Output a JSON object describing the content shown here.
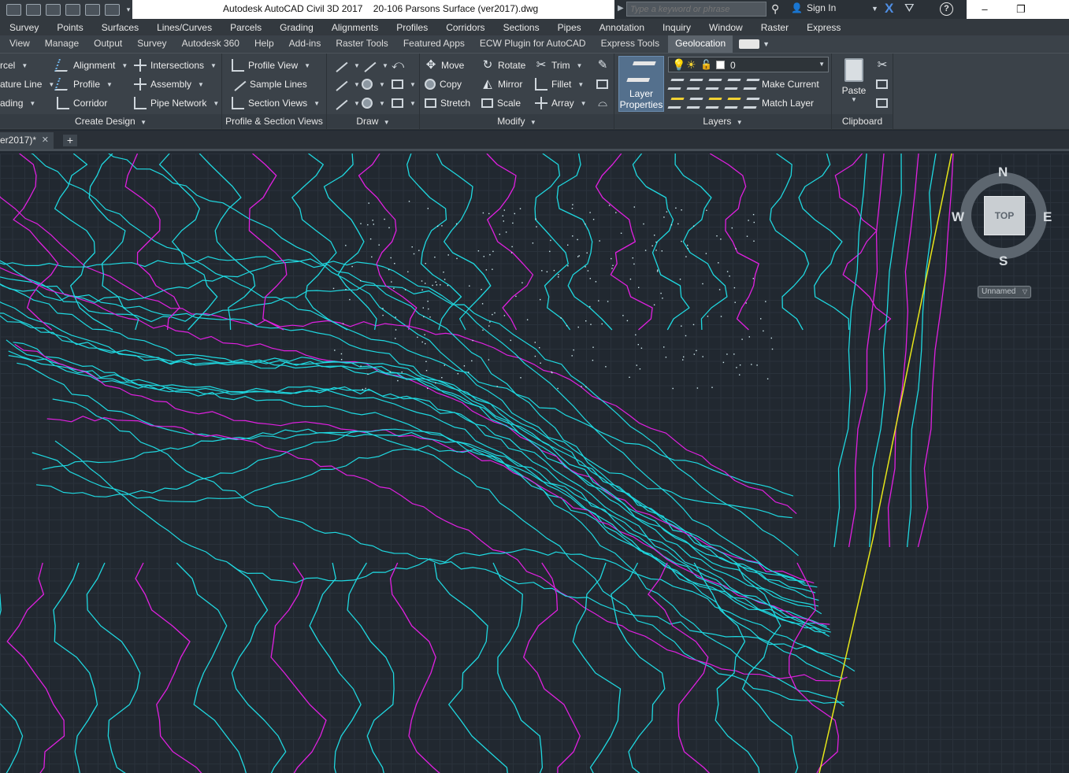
{
  "title_bar": {
    "app_title": "Autodesk AutoCAD Civil 3D 2017",
    "file_name": "20-106 Parsons Surface (ver2017).dwg",
    "search_placeholder": "Type a keyword or phrase",
    "sign_in": "Sign In",
    "minimize": "–",
    "restore": "❐"
  },
  "menu_bar": [
    "Survey",
    "Points",
    "Surfaces",
    "Lines/Curves",
    "Parcels",
    "Grading",
    "Alignments",
    "Profiles",
    "Corridors",
    "Sections",
    "Pipes",
    "Annotation",
    "Inquiry",
    "Window",
    "Raster",
    "Express"
  ],
  "ribbon_tabs": [
    "View",
    "Manage",
    "Output",
    "Survey",
    "Autodesk 360",
    "Help",
    "Add-ins",
    "Raster Tools",
    "Featured Apps",
    "ECW Plugin for AutoCAD",
    "Express Tools",
    "Geolocation"
  ],
  "active_tab": "Geolocation",
  "panels": {
    "create_design": {
      "title": "Create Design",
      "col1": [
        "rcel",
        "ature Line",
        "ading"
      ],
      "col2": [
        "Alignment",
        "Profile",
        "Corridor"
      ],
      "col3": [
        "Intersections",
        "Assembly",
        "Pipe Network"
      ]
    },
    "profile_section": {
      "title": "Profile & Section Views",
      "items": [
        "Profile View",
        "Sample Lines",
        "Section Views"
      ]
    },
    "draw": {
      "title": "Draw"
    },
    "modify": {
      "title": "Modify",
      "col1": [
        "Move",
        "Copy",
        "Stretch"
      ],
      "col2": [
        "Rotate",
        "Mirror",
        "Scale"
      ],
      "col3": [
        "Trim",
        "Fillet",
        "Array"
      ]
    },
    "layers": {
      "title": "Layers",
      "layer_properties": "Layer Properties",
      "current_layer": "0",
      "make_current": "Make Current",
      "match_layer": "Match Layer"
    },
    "clipboard": {
      "title": "Clipboard",
      "paste": "Paste"
    }
  },
  "doc_tab": {
    "label": "er2017)*",
    "close": "✕",
    "new_tab": "+"
  },
  "viewcube": {
    "north": "N",
    "south": "S",
    "east": "E",
    "west": "W",
    "face": "TOP",
    "ucs": "Unnamed"
  },
  "colors": {
    "contour_major": "#e020e0",
    "contour_minor": "#1fd8e0",
    "boundary": "#e6e61a",
    "canvas": "#212830"
  }
}
